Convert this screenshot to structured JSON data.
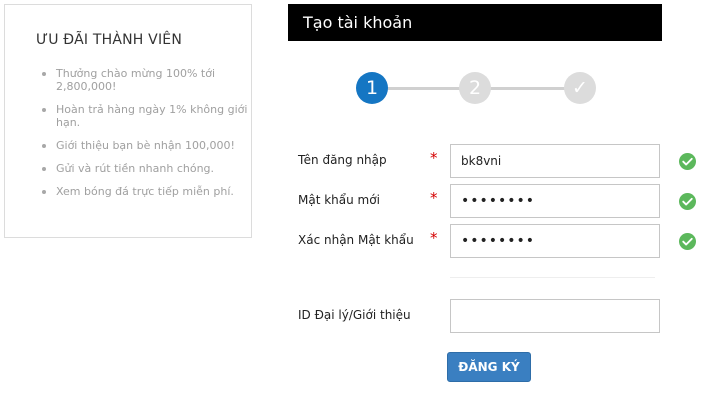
{
  "promo": {
    "title": "ƯU ĐÃI THÀNH VIÊN",
    "items": [
      "Thưởng chào mừng 100% tới 2,800,000!",
      "Hoàn trả hàng ngày 1% không giới hạn.",
      "Giới thiệu bạn bè nhận 100,000!",
      "Gửi và rút tiền nhanh chóng.",
      "Xem bóng đá trực tiếp miễn phí."
    ]
  },
  "header": {
    "title": "Tạo tài khoản"
  },
  "stepper": {
    "steps": [
      "1",
      "2",
      "✓"
    ],
    "current_step": 1,
    "colors": {
      "active": "#1576c3",
      "inactive": "#dcdcdc"
    }
  },
  "form": {
    "username": {
      "label": "Tên đăng nhập",
      "required": "*",
      "value": "bk8vni"
    },
    "password": {
      "label": "Mật khẩu mới",
      "required": "*",
      "value": "••••••••"
    },
    "confirm_password": {
      "label": "Xác nhận Mật khẩu",
      "required": "*",
      "value": "••••••••"
    },
    "referral": {
      "label": "ID Đại lý/Giới thiệu",
      "value": ""
    },
    "submit_label": "ĐĂNG KÝ"
  },
  "colors": {
    "header_bg": "#000000",
    "valid": "#5cb85c",
    "required": "#d40000",
    "button": "#3a7fc1"
  }
}
